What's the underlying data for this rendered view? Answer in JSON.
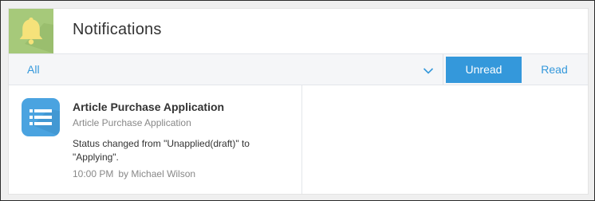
{
  "header": {
    "title": "Notifications",
    "icon": "bell-icon",
    "icon_bg": "#a6c97a",
    "icon_color": "#f6e27a"
  },
  "filter": {
    "selected": "All",
    "chevron_icon": "chevron-down-icon"
  },
  "tabs": {
    "unread_label": "Unread",
    "read_label": "Read",
    "active": "Unread",
    "accent": "#3498db"
  },
  "notifications": [
    {
      "icon": "list-app-icon",
      "title": "Article Purchase Application",
      "subtitle": "Article Purchase Application",
      "message": "Status changed from \"Unapplied(draft)\" to \"Applying\".",
      "time": "10:00 PM",
      "author": "by Michael Wilson"
    }
  ]
}
